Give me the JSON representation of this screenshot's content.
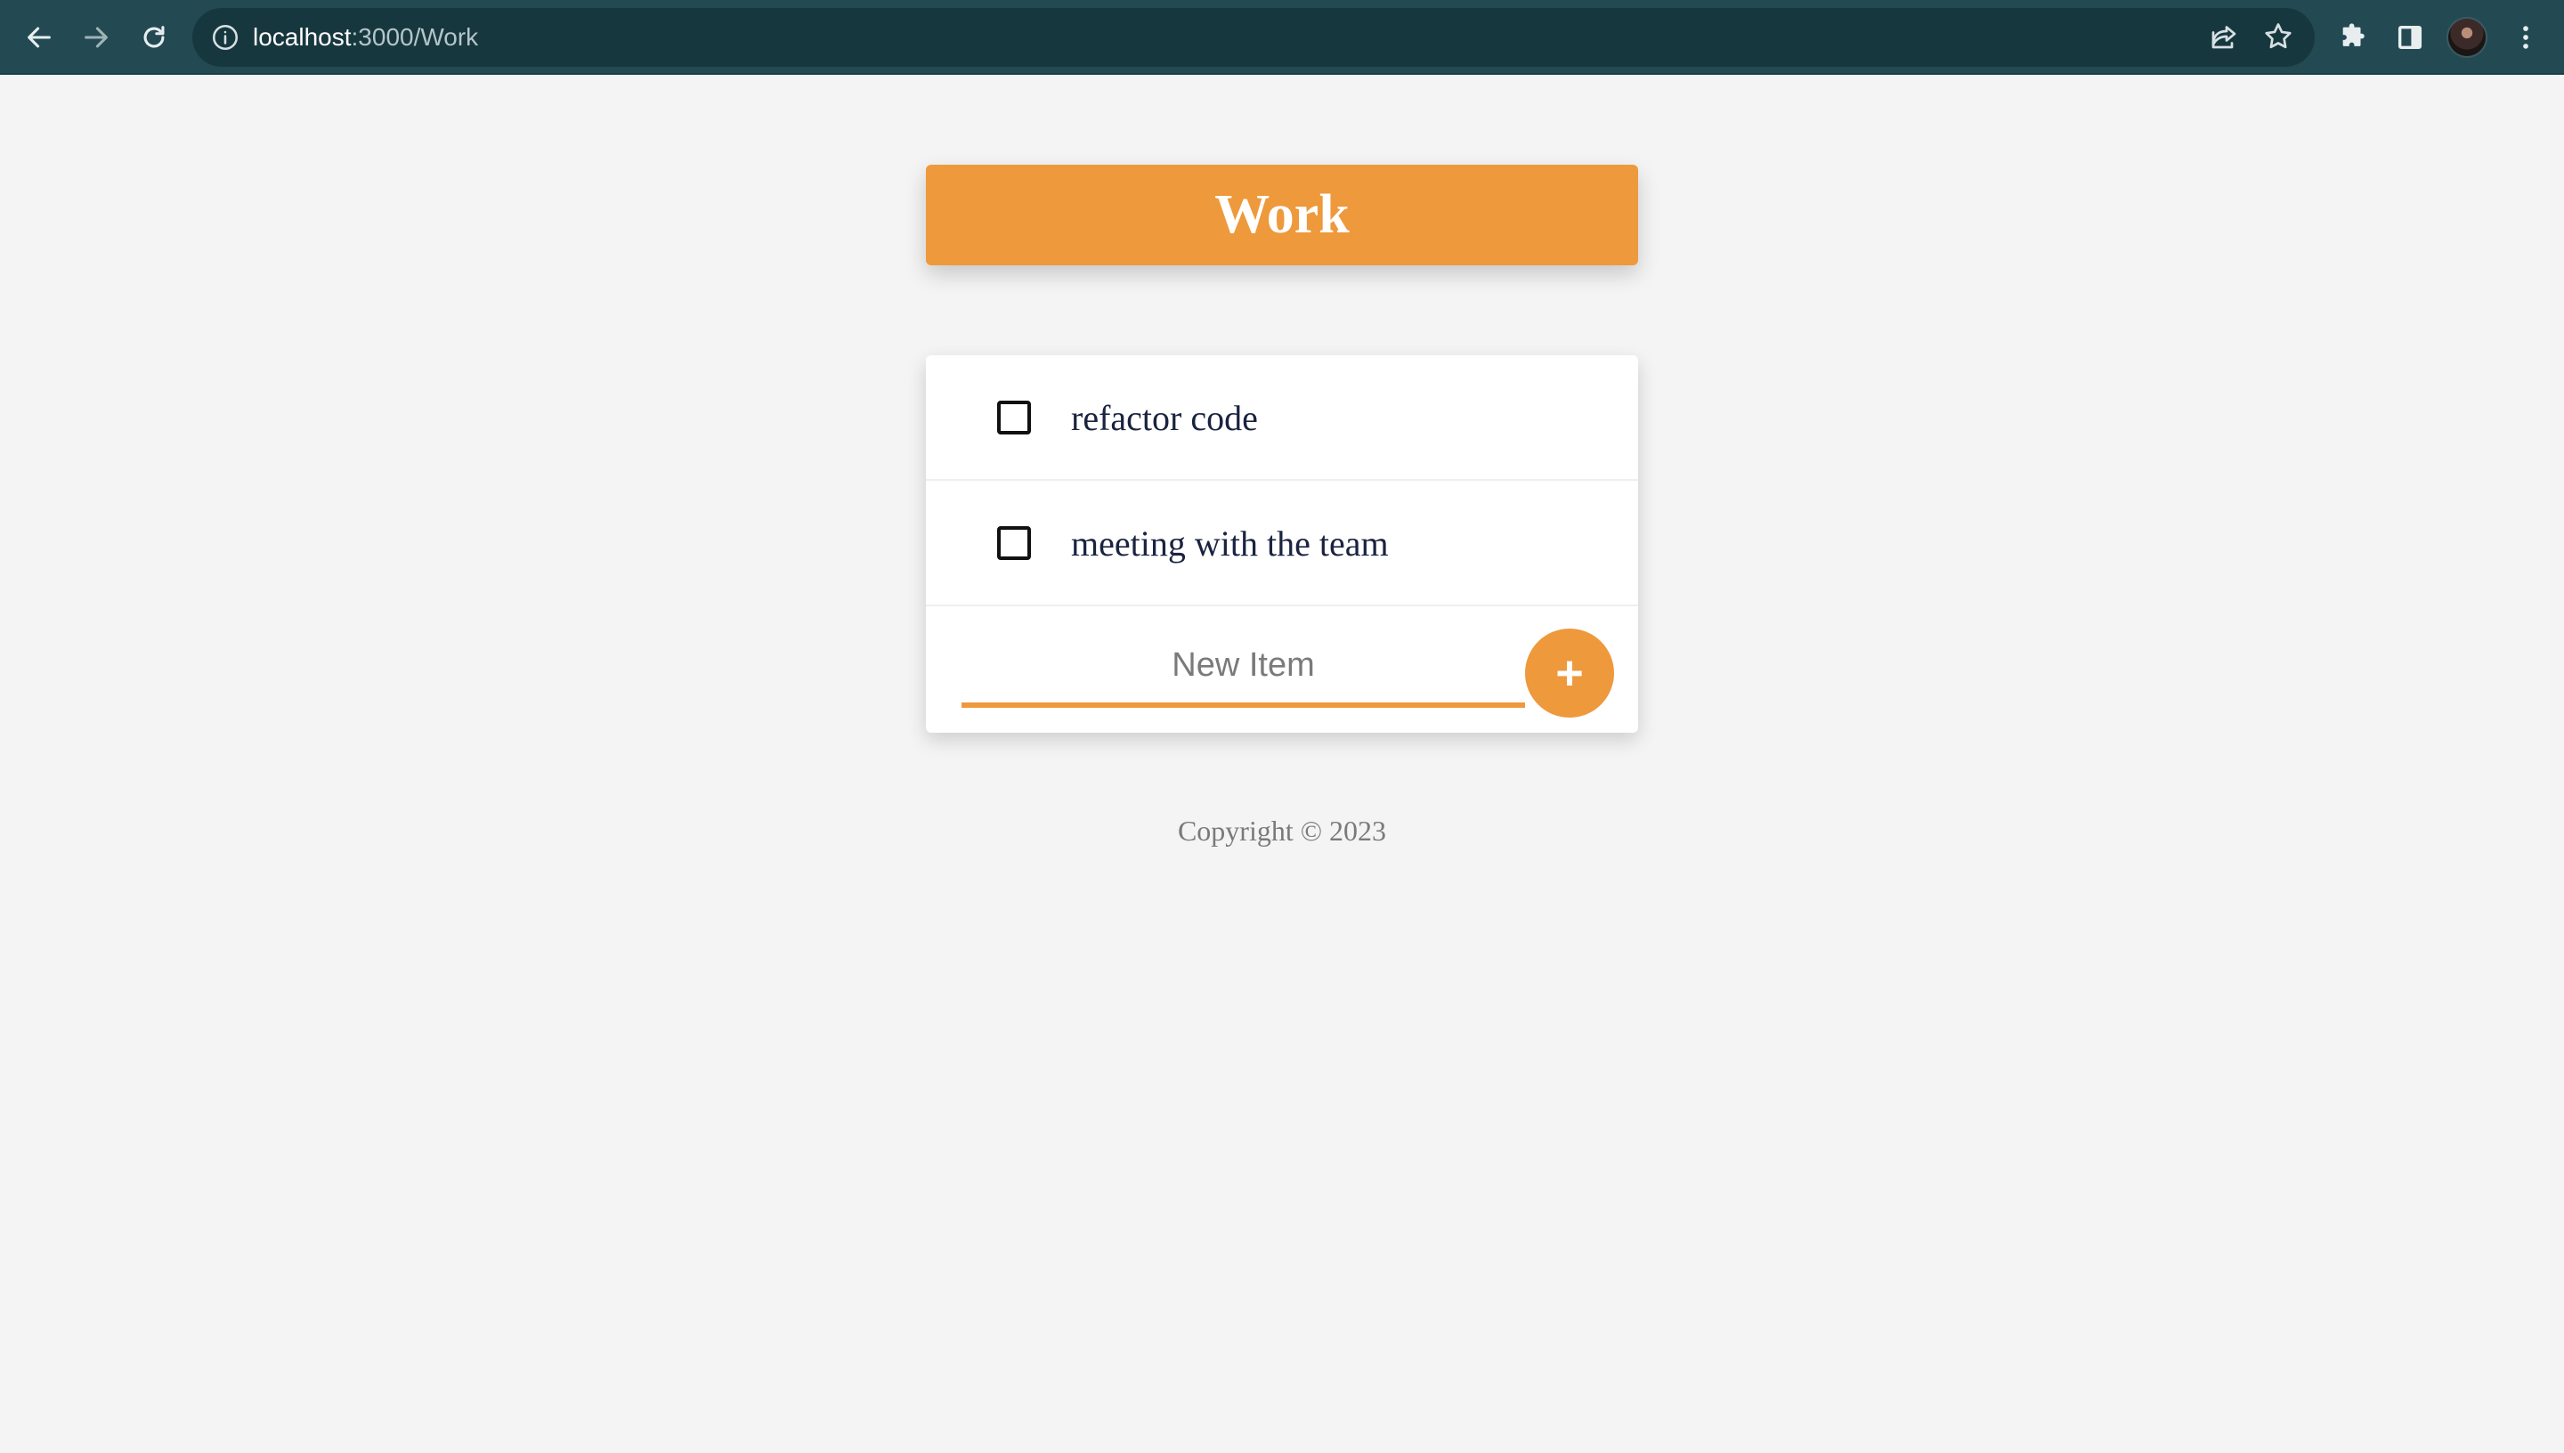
{
  "browser": {
    "url_host": "localhost",
    "url_path": ":3000/Work",
    "icons": {
      "back": "back-arrow-icon",
      "forward": "forward-arrow-icon",
      "reload": "reload-icon",
      "info": "info-icon",
      "share": "share-icon",
      "bookmark": "star-icon",
      "extensions": "puzzle-icon",
      "side_panel": "side-panel-icon",
      "menu": "kebab-menu-icon"
    },
    "colors": {
      "toolbar": "#234a52",
      "omnibox": "#17373e"
    }
  },
  "page": {
    "title": "Work",
    "items": [
      {
        "label": "refactor code",
        "checked": false
      },
      {
        "label": "meeting with the team",
        "checked": false
      }
    ],
    "new_item": {
      "placeholder": "New Item",
      "value": "",
      "add_label": "+"
    },
    "footer": "Copyright © 2023",
    "colors": {
      "accent": "#ee993c",
      "background": "#f4f4f4",
      "card": "#ffffff"
    }
  }
}
